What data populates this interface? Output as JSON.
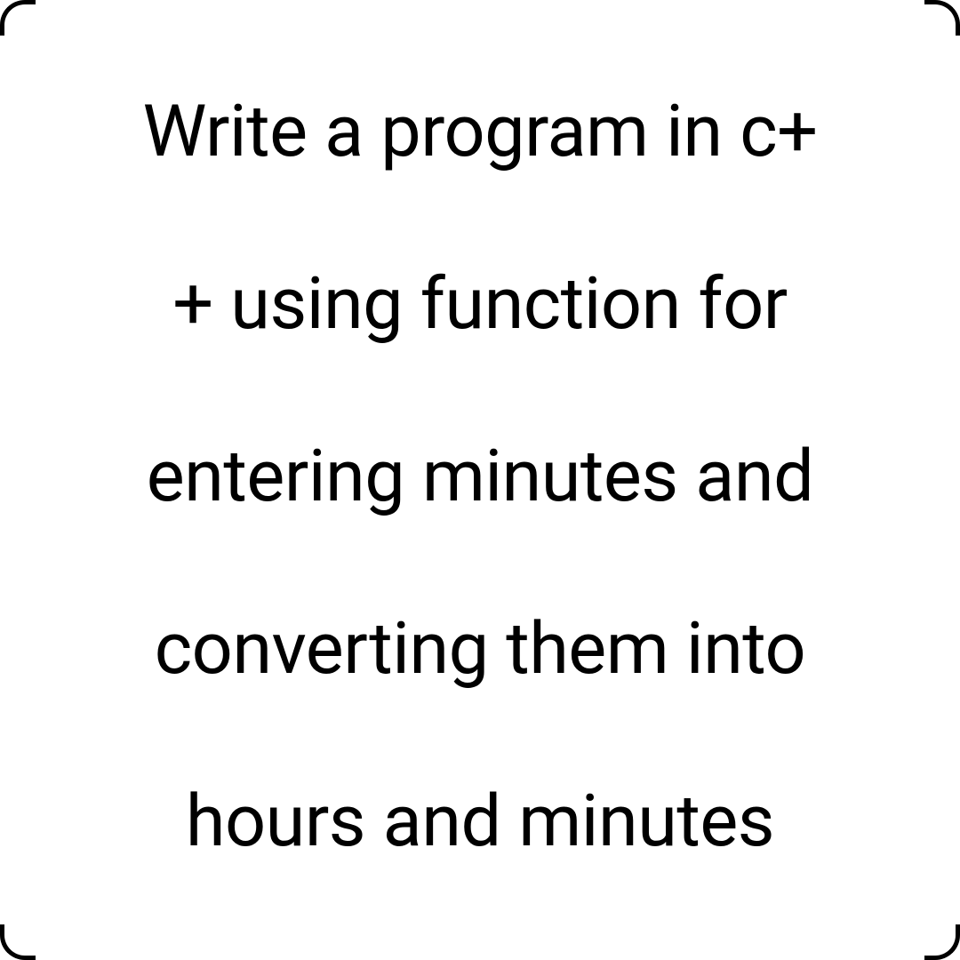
{
  "lines": {
    "l1": "Write a program in c+",
    "l2": "+ using function  for",
    "l3": "entering minutes and",
    "l4": "converting them into",
    "l5": "hours and minutes"
  }
}
